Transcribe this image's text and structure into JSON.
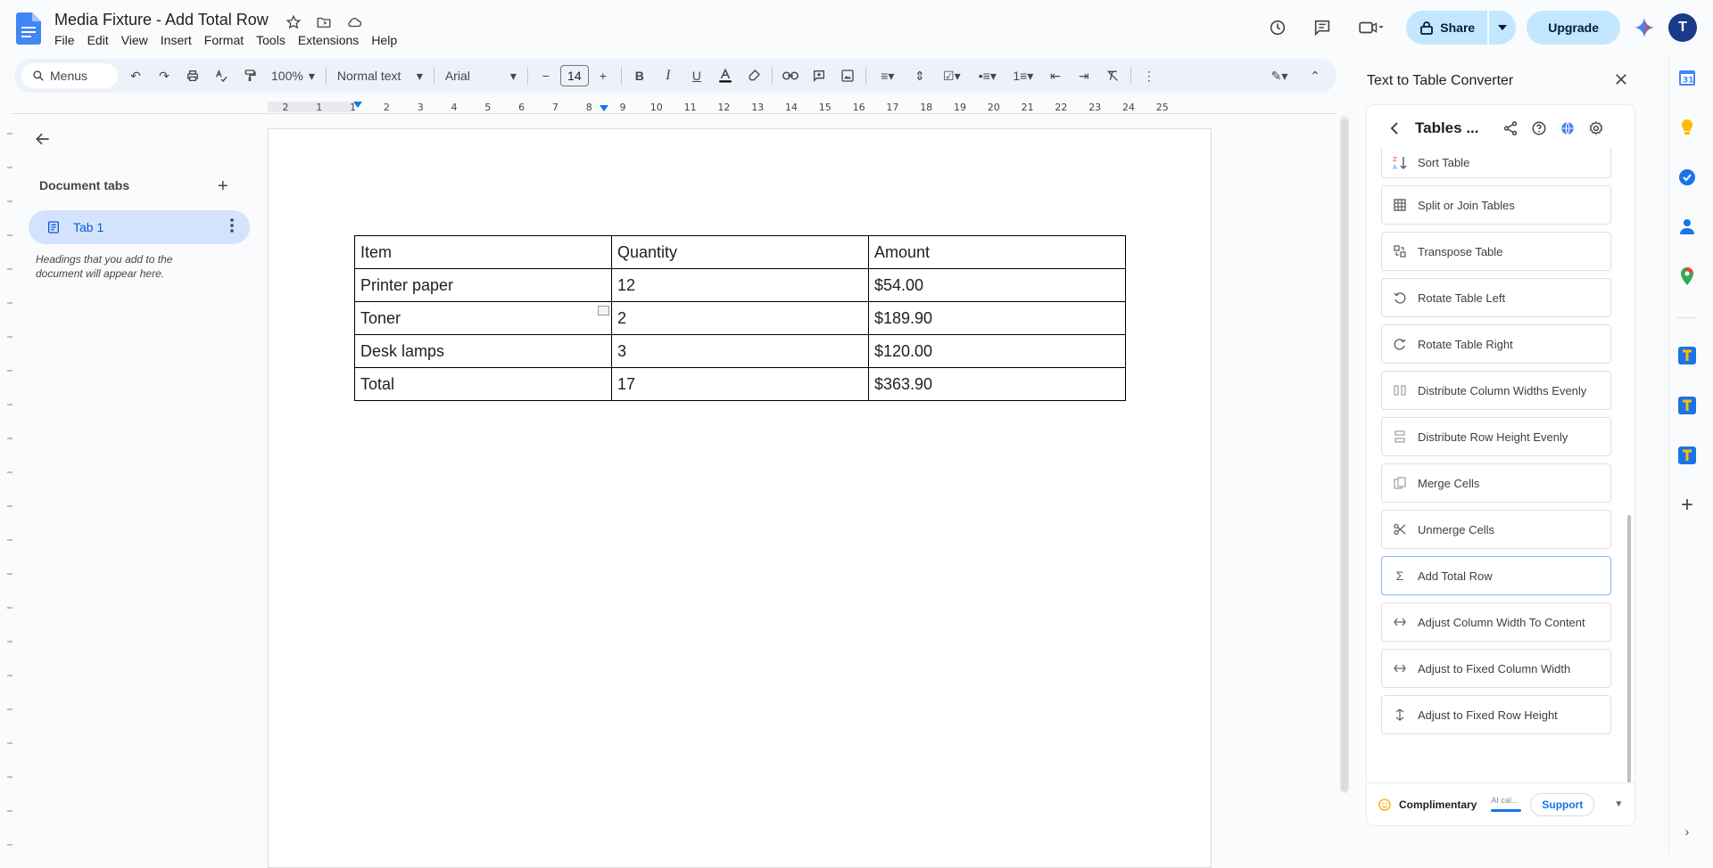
{
  "doc": {
    "title": "Media Fixture - Add Total Row",
    "menu": [
      "File",
      "Edit",
      "View",
      "Insert",
      "Format",
      "Tools",
      "Extensions",
      "Help"
    ]
  },
  "header": {
    "share_label": "Share",
    "upgrade_label": "Upgrade",
    "avatar_initial": "T"
  },
  "toolbar": {
    "search_label": "Menus",
    "zoom": "100%",
    "style": "Normal text",
    "font": "Arial",
    "font_size": "14"
  },
  "ruler": {
    "labels": [
      "2",
      "1",
      "1",
      "2",
      "3",
      "4",
      "5",
      "6",
      "7",
      "8",
      "9",
      "10",
      "11",
      "12",
      "13",
      "14",
      "15",
      "16",
      "17",
      "18",
      "19",
      "20",
      "21",
      "22",
      "23",
      "24",
      "25"
    ]
  },
  "left_panel": {
    "title": "Document tabs",
    "tab_label": "Tab 1",
    "hint": "Headings that you add to the document will appear here."
  },
  "table": {
    "rows": [
      [
        "Item",
        "Quantity",
        "Amount"
      ],
      [
        "Printer paper",
        "12",
        "$54.00"
      ],
      [
        "Toner",
        "2",
        "$189.90"
      ],
      [
        "Desk lamps",
        "3",
        "$120.00"
      ],
      [
        "Total",
        "17",
        "$363.90"
      ]
    ]
  },
  "side_panel": {
    "title": "Text to Table Converter",
    "header_title": "Tables ...",
    "items": [
      {
        "label": "Sort Table",
        "icon": "sort-az-icon"
      },
      {
        "label": "Split or Join Tables",
        "icon": "table-grid-icon"
      },
      {
        "label": "Transpose Table",
        "icon": "transpose-icon"
      },
      {
        "label": "Rotate Table Left",
        "icon": "rotate-left-icon"
      },
      {
        "label": "Rotate Table Right",
        "icon": "rotate-right-icon"
      },
      {
        "label": "Distribute Column Widths Evenly",
        "icon": "distribute-columns-icon"
      },
      {
        "label": "Distribute Row Height Evenly",
        "icon": "distribute-rows-icon"
      },
      {
        "label": "Merge Cells",
        "icon": "merge-icon"
      },
      {
        "label": "Unmerge Cells",
        "icon": "scissors-icon"
      },
      {
        "label": "Add Total Row",
        "icon": "sigma-icon"
      },
      {
        "label": "Adjust Column Width To Content",
        "icon": "expand-horizontal-icon"
      },
      {
        "label": "Adjust to Fixed Column Width",
        "icon": "expand-horizontal-icon"
      },
      {
        "label": "Adjust to Fixed Row Height",
        "icon": "expand-vertical-icon"
      }
    ],
    "footer": {
      "plan_label": "Complimentary",
      "ai_label": "AI cal...",
      "support_label": "Support"
    }
  }
}
